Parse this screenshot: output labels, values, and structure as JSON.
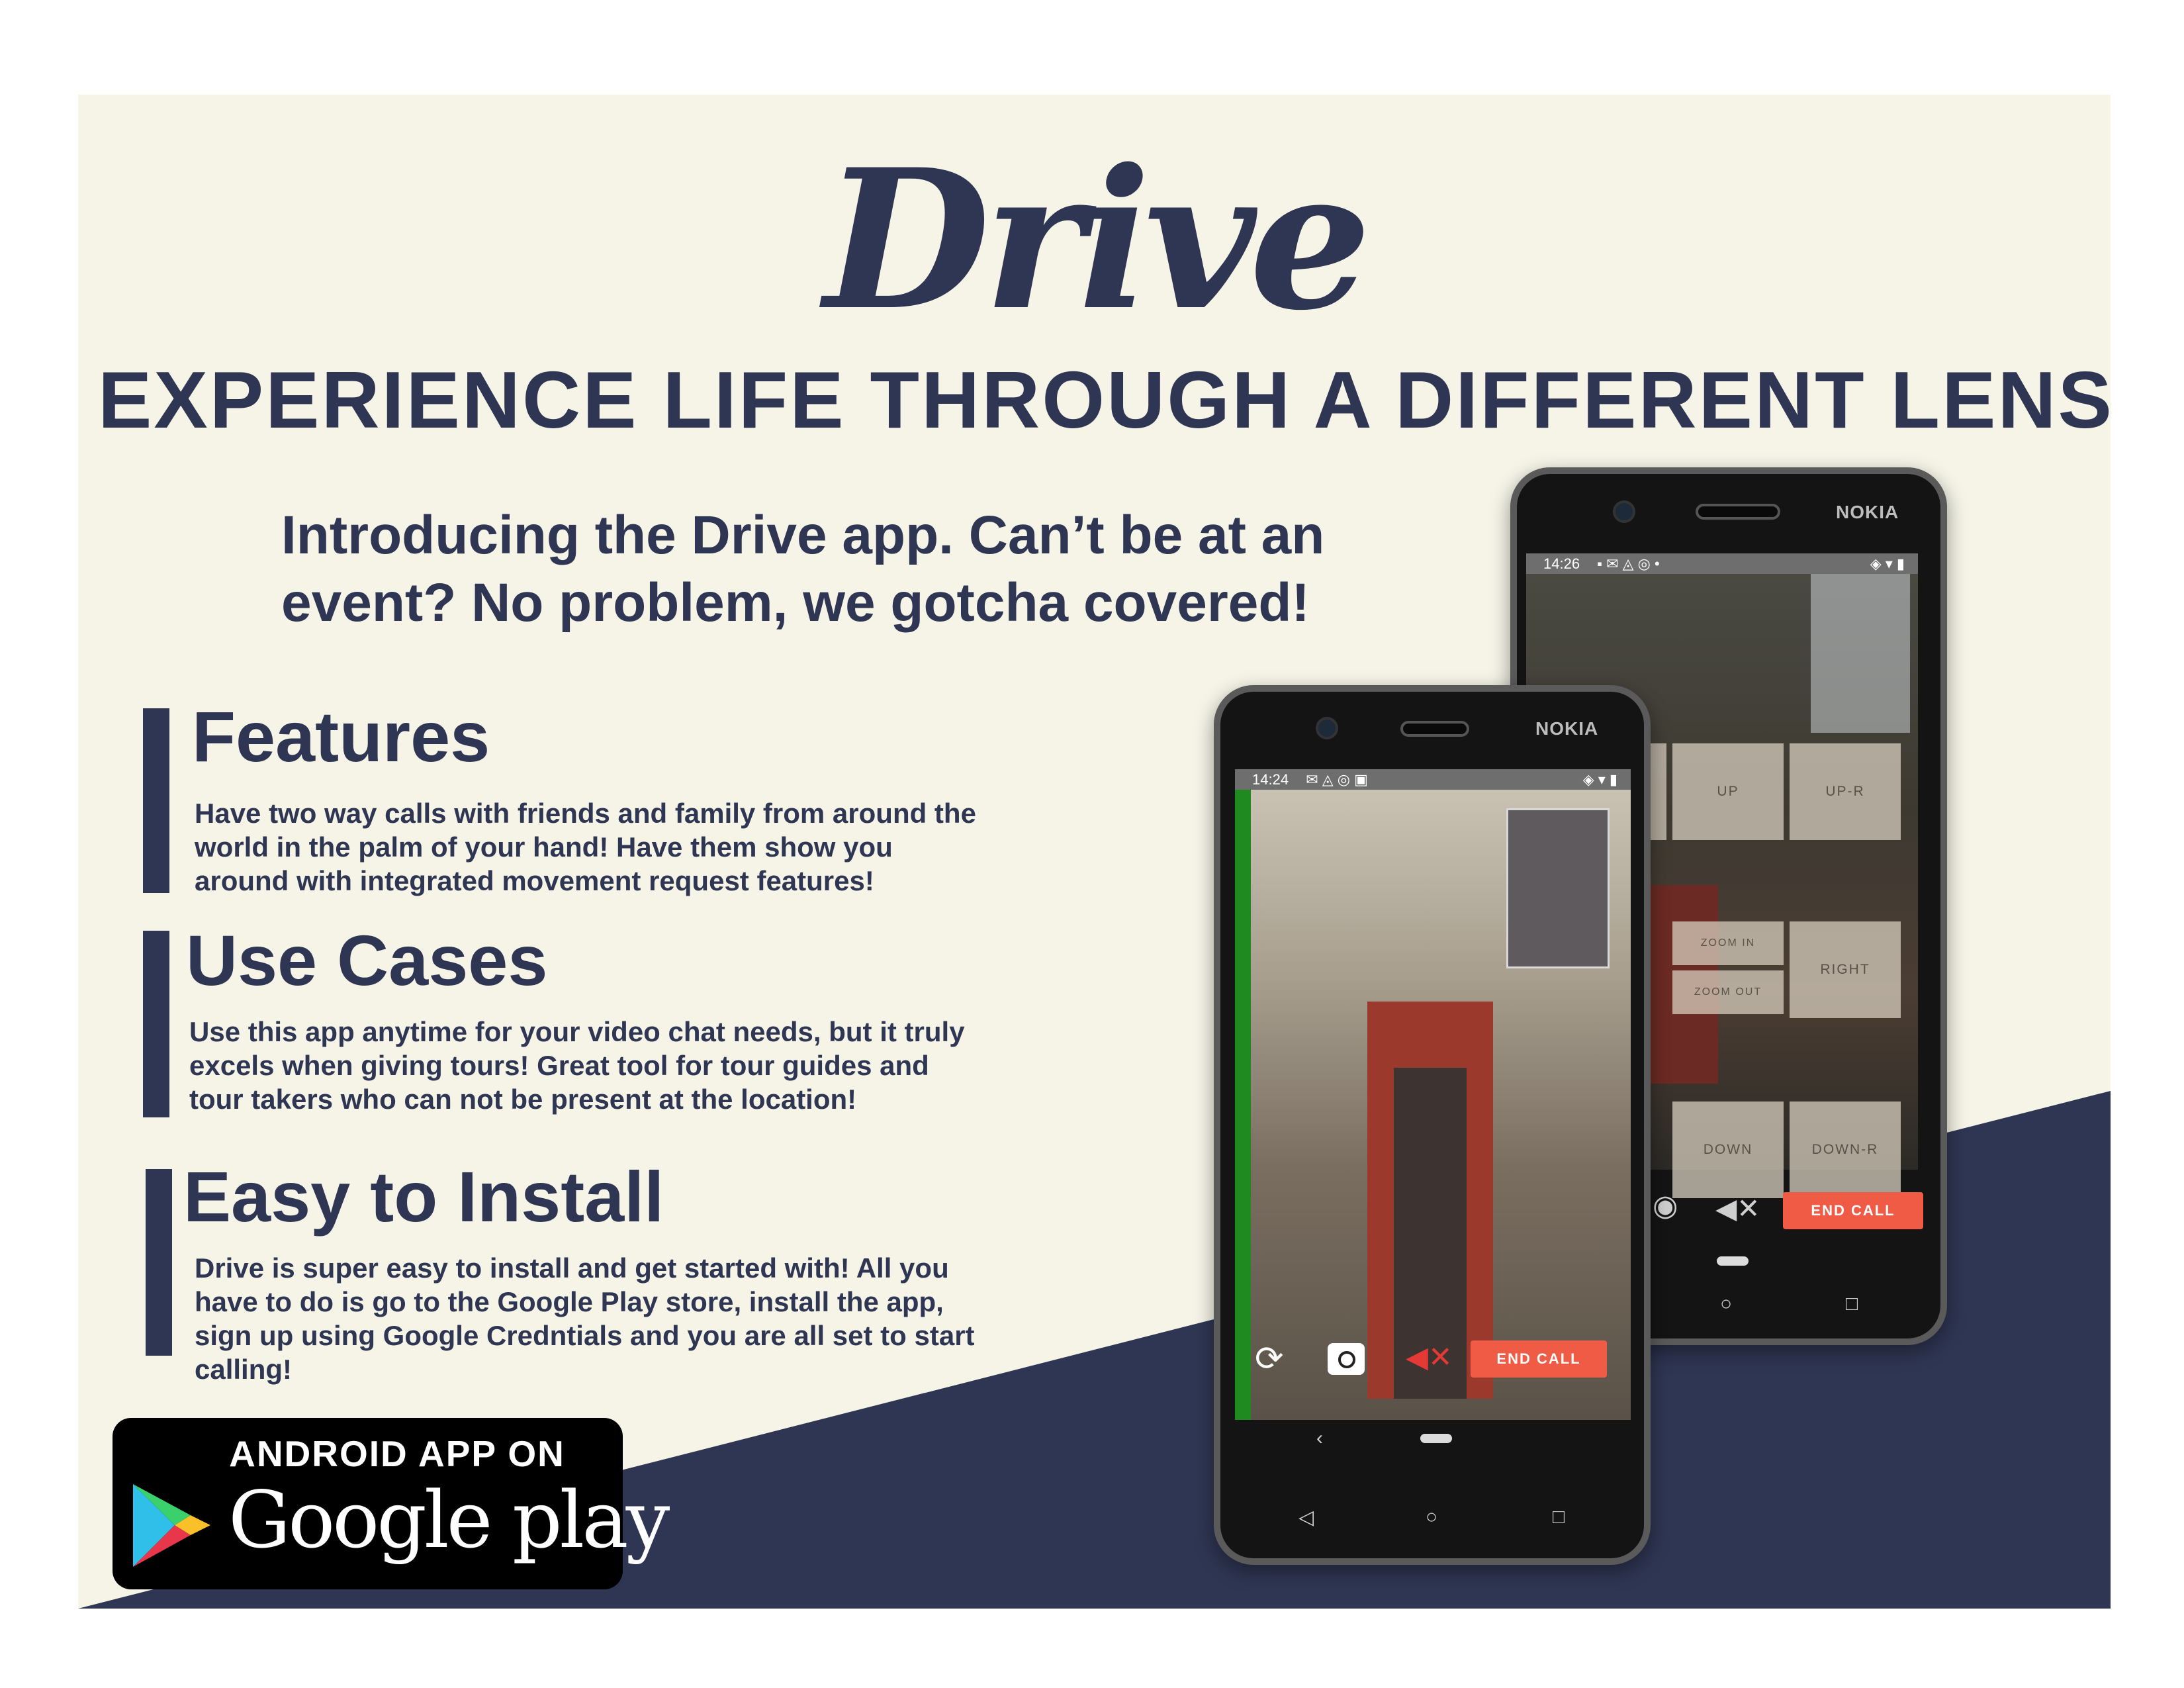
{
  "colors": {
    "navy": "#2f3653",
    "cream": "#f5f4e7",
    "accent_red": "#ef5b45",
    "call_green": "#1f8a1f"
  },
  "logo": {
    "text": "Drive"
  },
  "tagline": {
    "text": "EXPERIENCE LIFE THROUGH A DIFFERENT LENS",
    "exclaim": "!"
  },
  "intro": {
    "line1": "Introducing the Drive app. Can’t be at an",
    "line2": "event? No problem, we gotcha covered!"
  },
  "sections": {
    "features": {
      "title": "Features",
      "line1": "Have two way calls with friends and family from around the",
      "line2": "world in the palm of your hand! Have them show you",
      "line3": "around with integrated movement request features!"
    },
    "use_cases": {
      "title": "Use Cases",
      "line1": "Use this app anytime for your video chat needs, but it truly",
      "line2": "excels when giving tours! Great tool for tour guides and",
      "line3": "tour takers who can not be present at the location!"
    },
    "install": {
      "title": "Easy to Install",
      "line1": "Drive is super easy to install and get started with! All you",
      "line2": "have to do is go to the Google Play store, install the app,",
      "line3": "sign up using Google Credntials and you are all set to start",
      "line4": "calling!"
    }
  },
  "badge": {
    "top": "ANDROID APP ON",
    "bottom": "Google play",
    "icon": "google-play-triangle-icon"
  },
  "phone_back": {
    "brand": "NOKIA",
    "time": "14:26",
    "controls": {
      "up": "UP",
      "up_r": "UP-R",
      "zoom_in": "ZOOM IN",
      "zoom_out": "ZOOM OUT",
      "right": "RIGHT",
      "down": "DOWN",
      "down_r": "DOWN-R"
    },
    "end_call": "END CALL",
    "icons": [
      "camera-icon",
      "mute-icon",
      "home-icon",
      "recents-icon"
    ]
  },
  "phone_front": {
    "brand": "NOKIA",
    "time": "14:24",
    "end_call": "END CALL",
    "back_nav": "‹",
    "icons": [
      "rotate-camera-icon",
      "camera-icon",
      "mute-icon",
      "back-icon",
      "home-icon",
      "recents-icon"
    ]
  }
}
